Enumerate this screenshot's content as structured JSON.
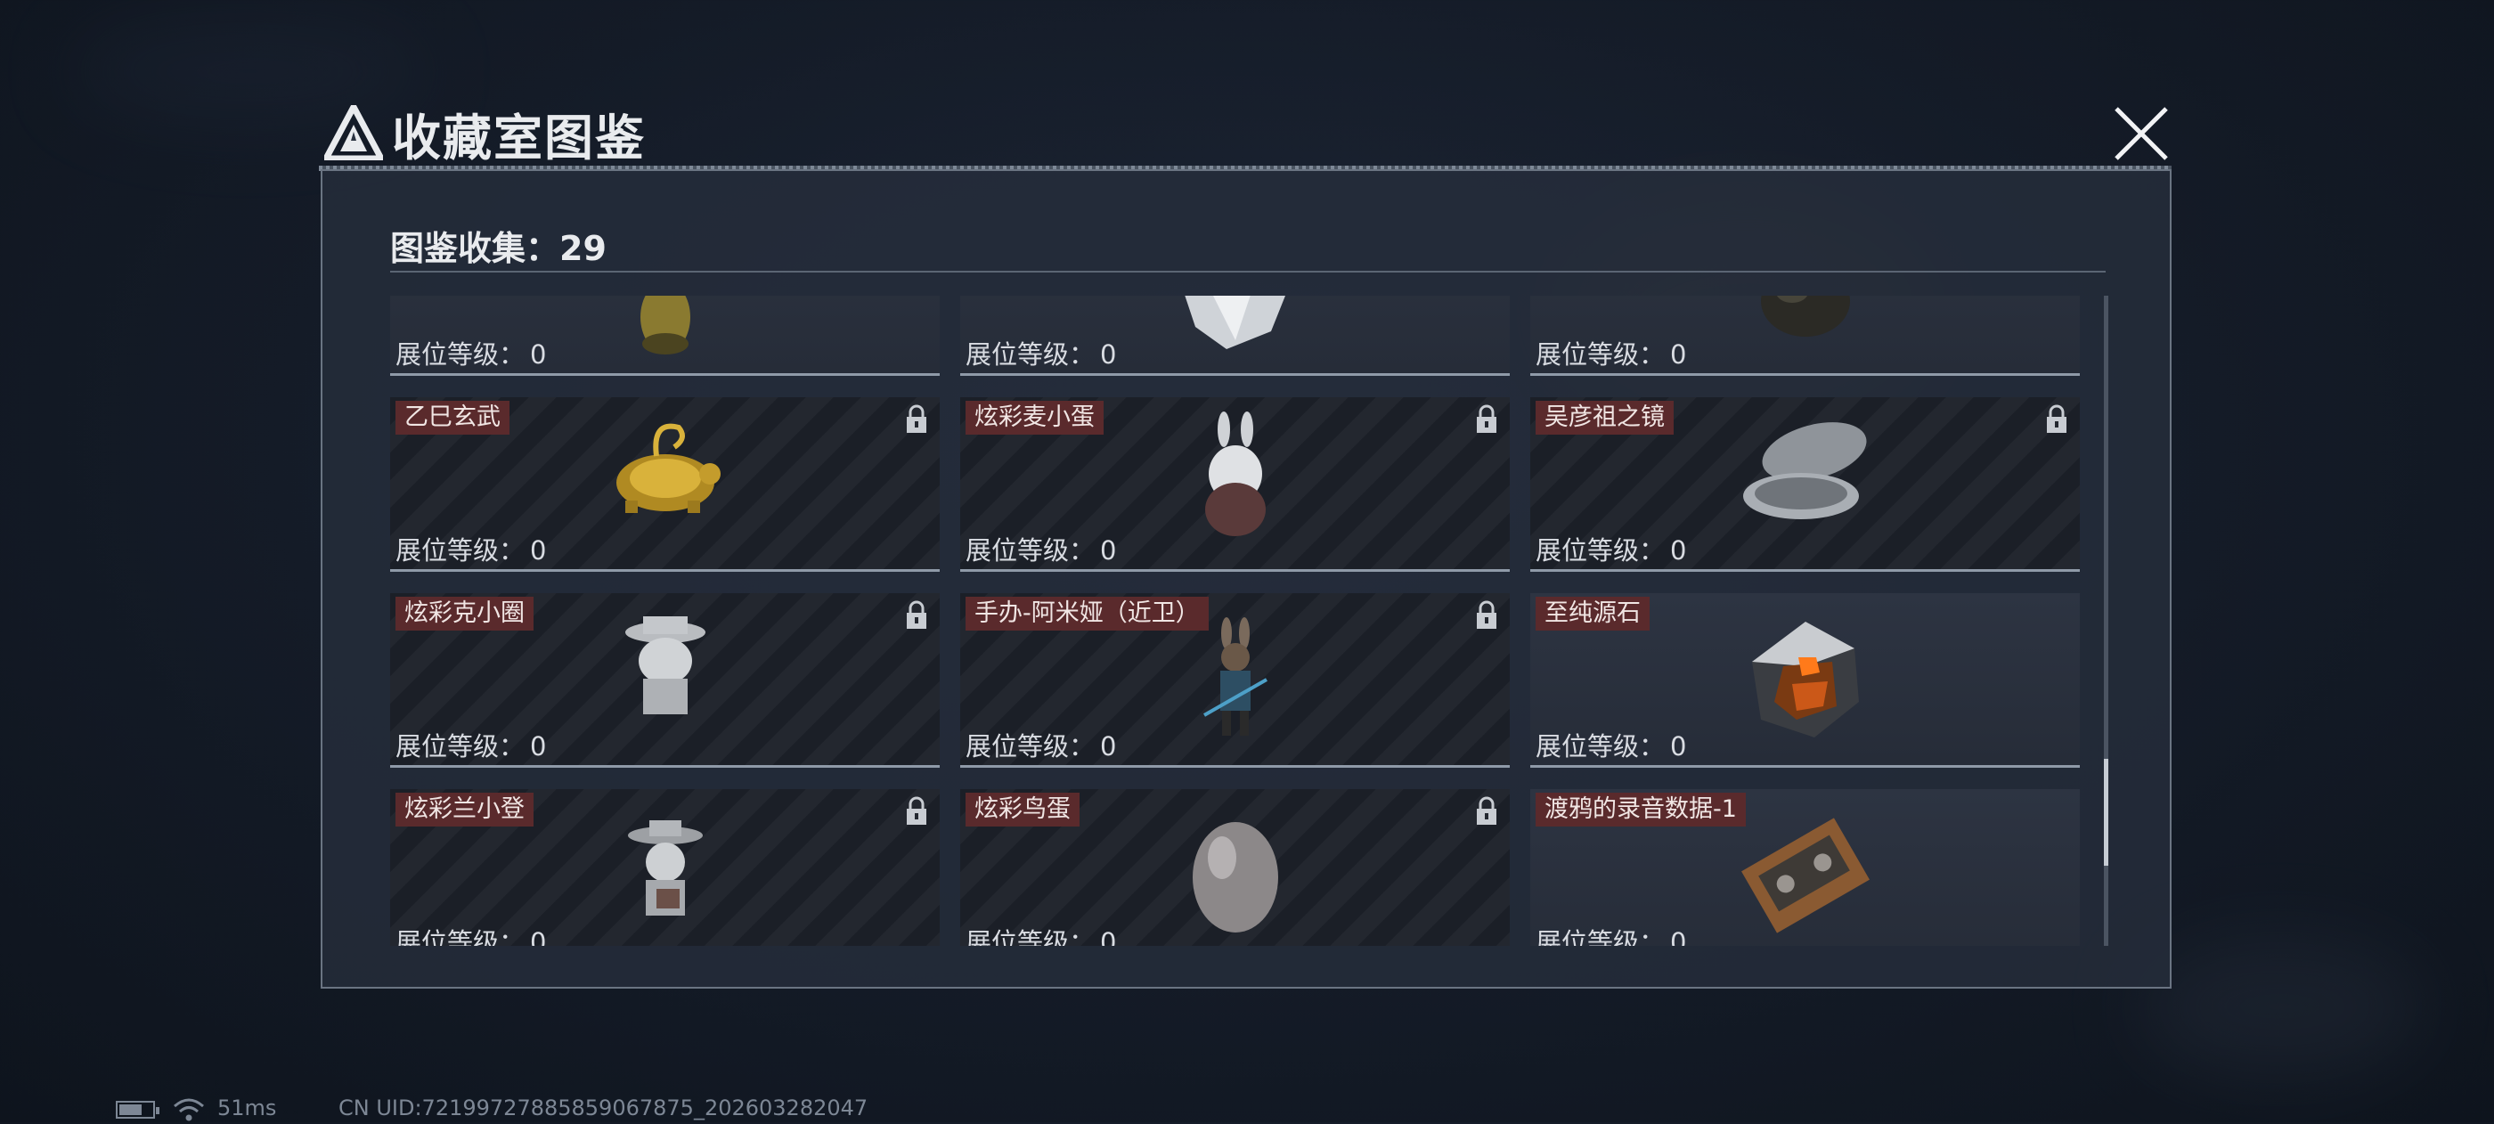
{
  "header": {
    "title": "收藏室图鉴"
  },
  "collection": {
    "count_label": "图鉴收集：29"
  },
  "level_label": "展位等级：",
  "cards": [
    {
      "name": "",
      "level": "0",
      "locked": false,
      "icon": "gold-jar-icon"
    },
    {
      "name": "",
      "level": "0",
      "locked": false,
      "icon": "crystal-shard-icon"
    },
    {
      "name": "",
      "level": "0",
      "locked": false,
      "icon": "dark-orb-icon"
    },
    {
      "name": "乙巳玄武",
      "level": "0",
      "locked": true,
      "icon": "golden-turtle-icon"
    },
    {
      "name": "炫彩麦小蛋",
      "level": "0",
      "locked": true,
      "icon": "bunny-egg-figure-icon"
    },
    {
      "name": "吴彦祖之镜",
      "level": "0",
      "locked": true,
      "icon": "compact-mirror-icon"
    },
    {
      "name": "炫彩克小圈",
      "level": "0",
      "locked": true,
      "icon": "hat-figure-icon"
    },
    {
      "name": "手办-阿米娅（近卫）",
      "level": "0",
      "locked": true,
      "icon": "amiya-figure-icon"
    },
    {
      "name": "至纯源石",
      "level": "0",
      "locked": false,
      "icon": "originium-crystal-icon"
    },
    {
      "name": "炫彩兰小登",
      "level": "0",
      "locked": true,
      "icon": "sombrero-figure-icon"
    },
    {
      "name": "炫彩鸟蛋",
      "level": "0",
      "locked": true,
      "icon": "egg-icon"
    },
    {
      "name": "渡鸦的录音数据-1",
      "level": "0",
      "locked": false,
      "icon": "cassette-tape-icon"
    }
  ],
  "status": {
    "ping": "51ms",
    "uid": "CN UID:7219972788585906787​5_202603282047",
    "battery_level": 0.7
  }
}
